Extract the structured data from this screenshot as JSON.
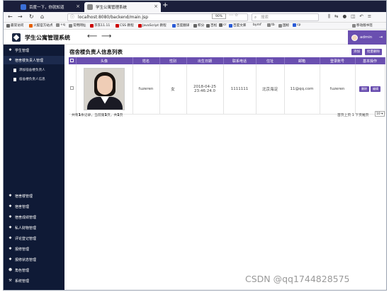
{
  "browser": {
    "tabs": [
      {
        "title": "百度一下，你就知道"
      },
      {
        "title": "学生公寓管理系统"
      }
    ],
    "url": "localhost:8080/backend/main.jsp",
    "zoom": "90%",
    "search_placeholder": "搜索",
    "bookmarks": [
      "最常访问",
      "火狐官方站点",
      "+q",
      "常用网址",
      "京东11.11",
      "CSS 教程",
      "JavaScript 教程",
      "百度翻译",
      "积分",
      "百松",
      "cr",
      "百度文库",
      "bymf",
      "tb",
      "国标",
      "cp",
      "移动版书签"
    ]
  },
  "app": {
    "title": "学生公寓管理系统",
    "user": "admin"
  },
  "sidebar": {
    "items": [
      {
        "label": "学生管理",
        "icon": "star-icon"
      },
      {
        "label": "宿舍楼负责人管理",
        "icon": "star-icon"
      },
      {
        "label": "宿舍楼管理",
        "icon": "star-icon"
      },
      {
        "label": "宿舍管理",
        "icon": "star-icon"
      },
      {
        "label": "宿舍成绩管理",
        "icon": "star-icon"
      },
      {
        "label": "私人财物管理",
        "icon": "star-icon"
      },
      {
        "label": "评论登记管理",
        "icon": "star-icon"
      },
      {
        "label": "报修管理",
        "icon": "star-icon"
      },
      {
        "label": "报修状态管理",
        "icon": "star-icon"
      },
      {
        "label": "角色管理",
        "icon": "users-icon"
      },
      {
        "label": "系统管理",
        "icon": "wrench-icon"
      }
    ],
    "subitems": [
      {
        "label": "添加宿舍楼负责人"
      },
      {
        "label": "宿舍楼负责人信息"
      }
    ]
  },
  "main": {
    "page_title": "宿舍楼负责人信息列表",
    "buttons": {
      "add": "添加",
      "batch_delete": "批量删除"
    },
    "columns": [
      "头像",
      "姓名",
      "性别",
      "出生日期",
      "联系电话",
      "住址",
      "邮箱",
      "登录账号",
      "基本操作"
    ],
    "rows": [
      {
        "name": "fuzeren",
        "gender": "女",
        "birth": "2018-04-25 23:46:24.0",
        "phone": "1111111",
        "address": "北京海淀",
        "email": "11@qq.com",
        "account": "fuzeren"
      }
    ],
    "row_actions": {
      "delete": "删除",
      "edit": "编辑"
    },
    "pager": {
      "total_prefix": "共有",
      "total": "1",
      "total_suffix": "条记录，当前第",
      "current": "1",
      "page_suffix": "页，共",
      "pages": "1",
      "end": "页",
      "nav": "首页上页 1 下页尾页",
      "page_size": "10"
    }
  },
  "watermark": "CSDN @qq1744828575"
}
